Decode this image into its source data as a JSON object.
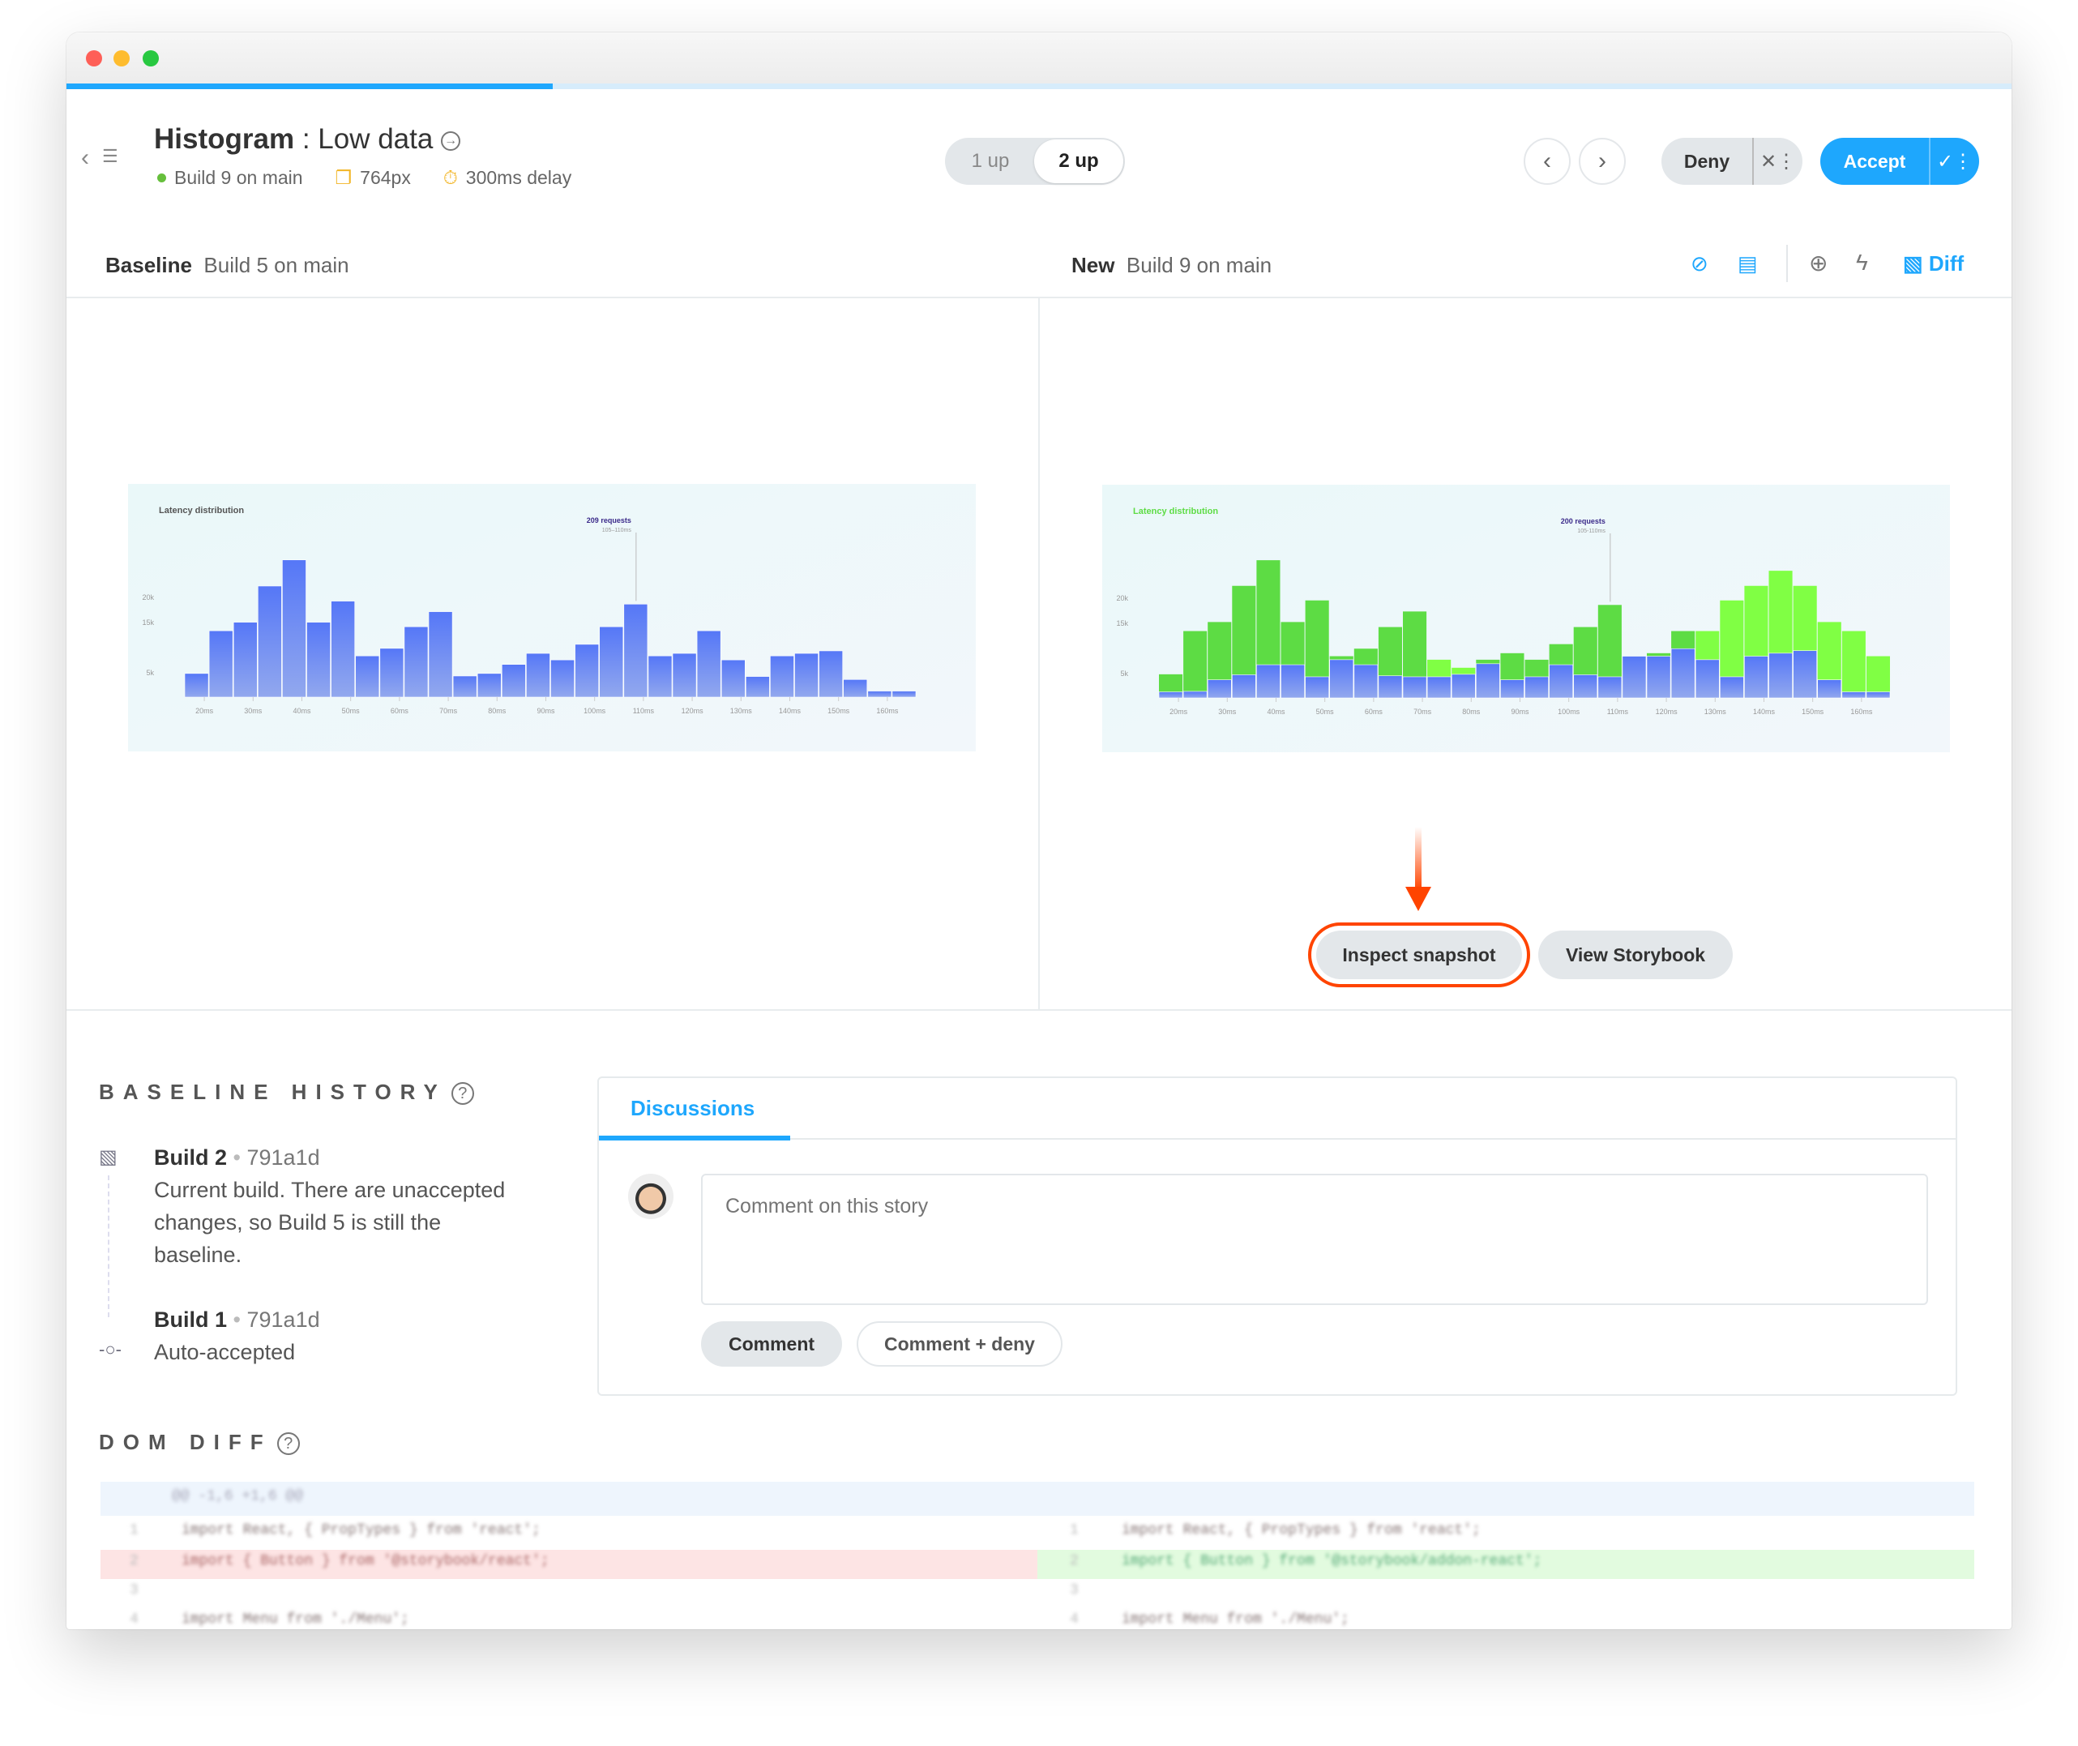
{
  "header": {
    "component": "Histogram",
    "separator": " : ",
    "story": "Low data",
    "build": "Build 9 on main",
    "viewport": "764px",
    "delay": "300ms delay",
    "view_modes": [
      "1 up",
      "2 up"
    ],
    "active_view_mode": "2 up",
    "deny_label": "Deny",
    "accept_label": "Accept",
    "progress_percent": 25
  },
  "compare": {
    "baseline_label": "Baseline",
    "baseline_build": "Build 5 on main",
    "new_label": "New",
    "new_build": "Build 9 on main",
    "diff_label": "Diff",
    "inspect_label": "Inspect snapshot",
    "storybook_label": "View Storybook"
  },
  "colors": {
    "accent": "#1ea7fd",
    "highlight": "#ff4400",
    "bar": "#6b8cf5",
    "diff_green": "#5ddc44",
    "diff_green_bright": "#80ff44",
    "status_green": "#66bf3c"
  },
  "chart_data": [
    {
      "type": "bar",
      "title": "Latency distribution",
      "tooltip": {
        "value": "209 requests",
        "range": "105–110ms",
        "bar_index": 18
      },
      "x_tick_labels": [
        "20ms",
        "30ms",
        "40ms",
        "50ms",
        "60ms",
        "70ms",
        "80ms",
        "90ms",
        "100ms",
        "110ms",
        "120ms",
        "130ms",
        "140ms",
        "150ms",
        "160ms"
      ],
      "y_tick_labels": [
        "5k",
        "15k",
        "20k"
      ],
      "y_ticks": [
        5000,
        15000,
        20000
      ],
      "values": [
        4700,
        13200,
        14900,
        22100,
        27300,
        14900,
        19100,
        8200,
        9700,
        14000,
        17000,
        4200,
        4700,
        6500,
        8700,
        7400,
        10500,
        14000,
        18500,
        8200,
        8700,
        13200,
        7400,
        4100,
        8200,
        8700,
        9200,
        3500,
        1200,
        1200
      ]
    },
    {
      "type": "bar",
      "title": "Latency distribution",
      "tooltip": {
        "value": "200 requests",
        "range": "105-110ms",
        "bar_index": 18
      },
      "x_tick_labels": [
        "20ms",
        "30ms",
        "40ms",
        "50ms",
        "60ms",
        "70ms",
        "80ms",
        "90ms",
        "100ms",
        "110ms",
        "120ms",
        "130ms",
        "140ms",
        "150ms",
        "160ms"
      ],
      "y_tick_labels": [
        "5k",
        "15k",
        "20k"
      ],
      "y_ticks": [
        5000,
        15000,
        20000
      ],
      "values": [
        1200,
        1300,
        3600,
        4600,
        6600,
        6600,
        4200,
        7600,
        6600,
        4400,
        4200,
        4200,
        4700,
        6800,
        3600,
        4200,
        6600,
        4600,
        4200,
        8300,
        8300,
        9800,
        7600,
        4200,
        8300,
        8900,
        9400,
        3600,
        1200,
        1200
      ],
      "diff_overlay_values": [
        4700,
        13300,
        15100,
        22300,
        27400,
        15100,
        19400,
        8300,
        9800,
        14100,
        17200,
        7600,
        6000,
        7600,
        8900,
        7600,
        10700,
        14100,
        18500,
        8300,
        8900,
        13300,
        13300,
        19400,
        22300,
        25300,
        22300,
        15100,
        13300,
        8300
      ],
      "diff_bright_indices": [
        11,
        12,
        22,
        23,
        24,
        25,
        26,
        27,
        28,
        29
      ]
    }
  ],
  "history": {
    "title": "BASELINE HISTORY",
    "items": [
      {
        "build": "Build 2",
        "sha": "791a1d",
        "lines": [
          "Current build. There are unaccepted",
          "changes, so Build 5 is still the",
          "baseline."
        ]
      },
      {
        "build": "Build 1",
        "sha": "791a1d",
        "lines": [
          "Auto-accepted"
        ]
      }
    ]
  },
  "discussions": {
    "tab": "Discussions",
    "placeholder": "Comment on this story",
    "comment_label": "Comment",
    "comment_deny_label": "Comment + deny"
  },
  "dom_diff": {
    "title": "DOM DIFF",
    "hunk": "@@ -1,6 +1,6 @@",
    "left": [
      {
        "num": "1",
        "code": "import React, { PropTypes } from 'react';"
      },
      {
        "num": "2",
        "code": "import { Button } from '@storybook/react';"
      },
      {
        "num": "3",
        "code": ""
      },
      {
        "num": "4",
        "code": "import Menu from './Menu';"
      }
    ],
    "right": [
      {
        "num": "1",
        "code": "import React, { PropTypes } from 'react';"
      },
      {
        "num": "2",
        "code": "import { Button } from '@storybook/addon-react';"
      },
      {
        "num": "3",
        "code": ""
      },
      {
        "num": "4",
        "code": "import Menu from './Menu';"
      }
    ]
  }
}
